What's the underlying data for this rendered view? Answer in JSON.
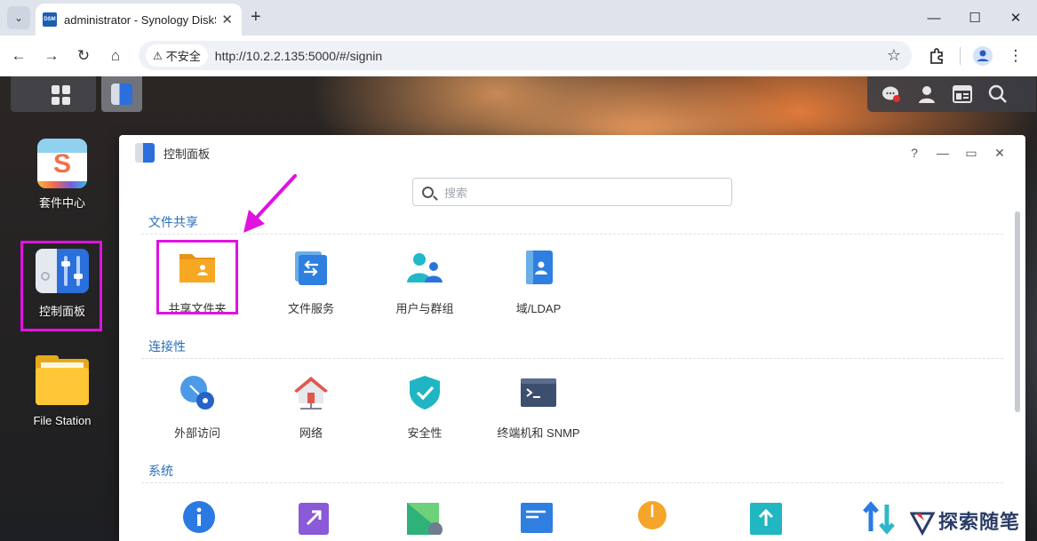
{
  "browser": {
    "tab_title": "administrator - Synology DiskStation",
    "favicon_text": "DSM",
    "tab_close": "✕",
    "new_tab": "+",
    "tab_menu": "⌄",
    "minimize": "—",
    "maximize": "☐",
    "close": "✕",
    "back": "←",
    "forward": "→",
    "reload": "↻",
    "home": "⌂",
    "security_label": "不安全",
    "security_glyph": "⚠",
    "url": "http://10.2.2.135:5000/#/signin",
    "bookmark_star": "☆",
    "menu_dots": "⋮"
  },
  "desktop": {
    "icons": [
      {
        "label": "套件中心",
        "icon": "package-center-icon"
      },
      {
        "label": "控制面板",
        "icon": "control-panel-icon"
      },
      {
        "label": "File Station",
        "icon": "file-station-icon"
      }
    ]
  },
  "window": {
    "title": "控制面板",
    "help": "?",
    "minimize": "—",
    "maximize": "▭",
    "close": "✕",
    "search_placeholder": "搜索",
    "sections": [
      {
        "title": "文件共享",
        "items": [
          {
            "label": "共享文件夹",
            "icon": "shared-folder-icon"
          },
          {
            "label": "文件服务",
            "icon": "file-services-icon"
          },
          {
            "label": "用户与群组",
            "icon": "user-group-icon"
          },
          {
            "label": "域/LDAP",
            "icon": "domain-ldap-icon"
          }
        ]
      },
      {
        "title": "连接性",
        "items": [
          {
            "label": "外部访问",
            "icon": "external-access-icon"
          },
          {
            "label": "网络",
            "icon": "network-icon"
          },
          {
            "label": "安全性",
            "icon": "security-shield-icon"
          },
          {
            "label": "终端机和 SNMP",
            "icon": "terminal-icon"
          }
        ]
      },
      {
        "title": "系统",
        "items": []
      }
    ]
  },
  "watermark": "探索随笔",
  "colors": {
    "accent": "#2a6fb8",
    "highlight": "#e012e0",
    "folder": "#f7a823"
  }
}
